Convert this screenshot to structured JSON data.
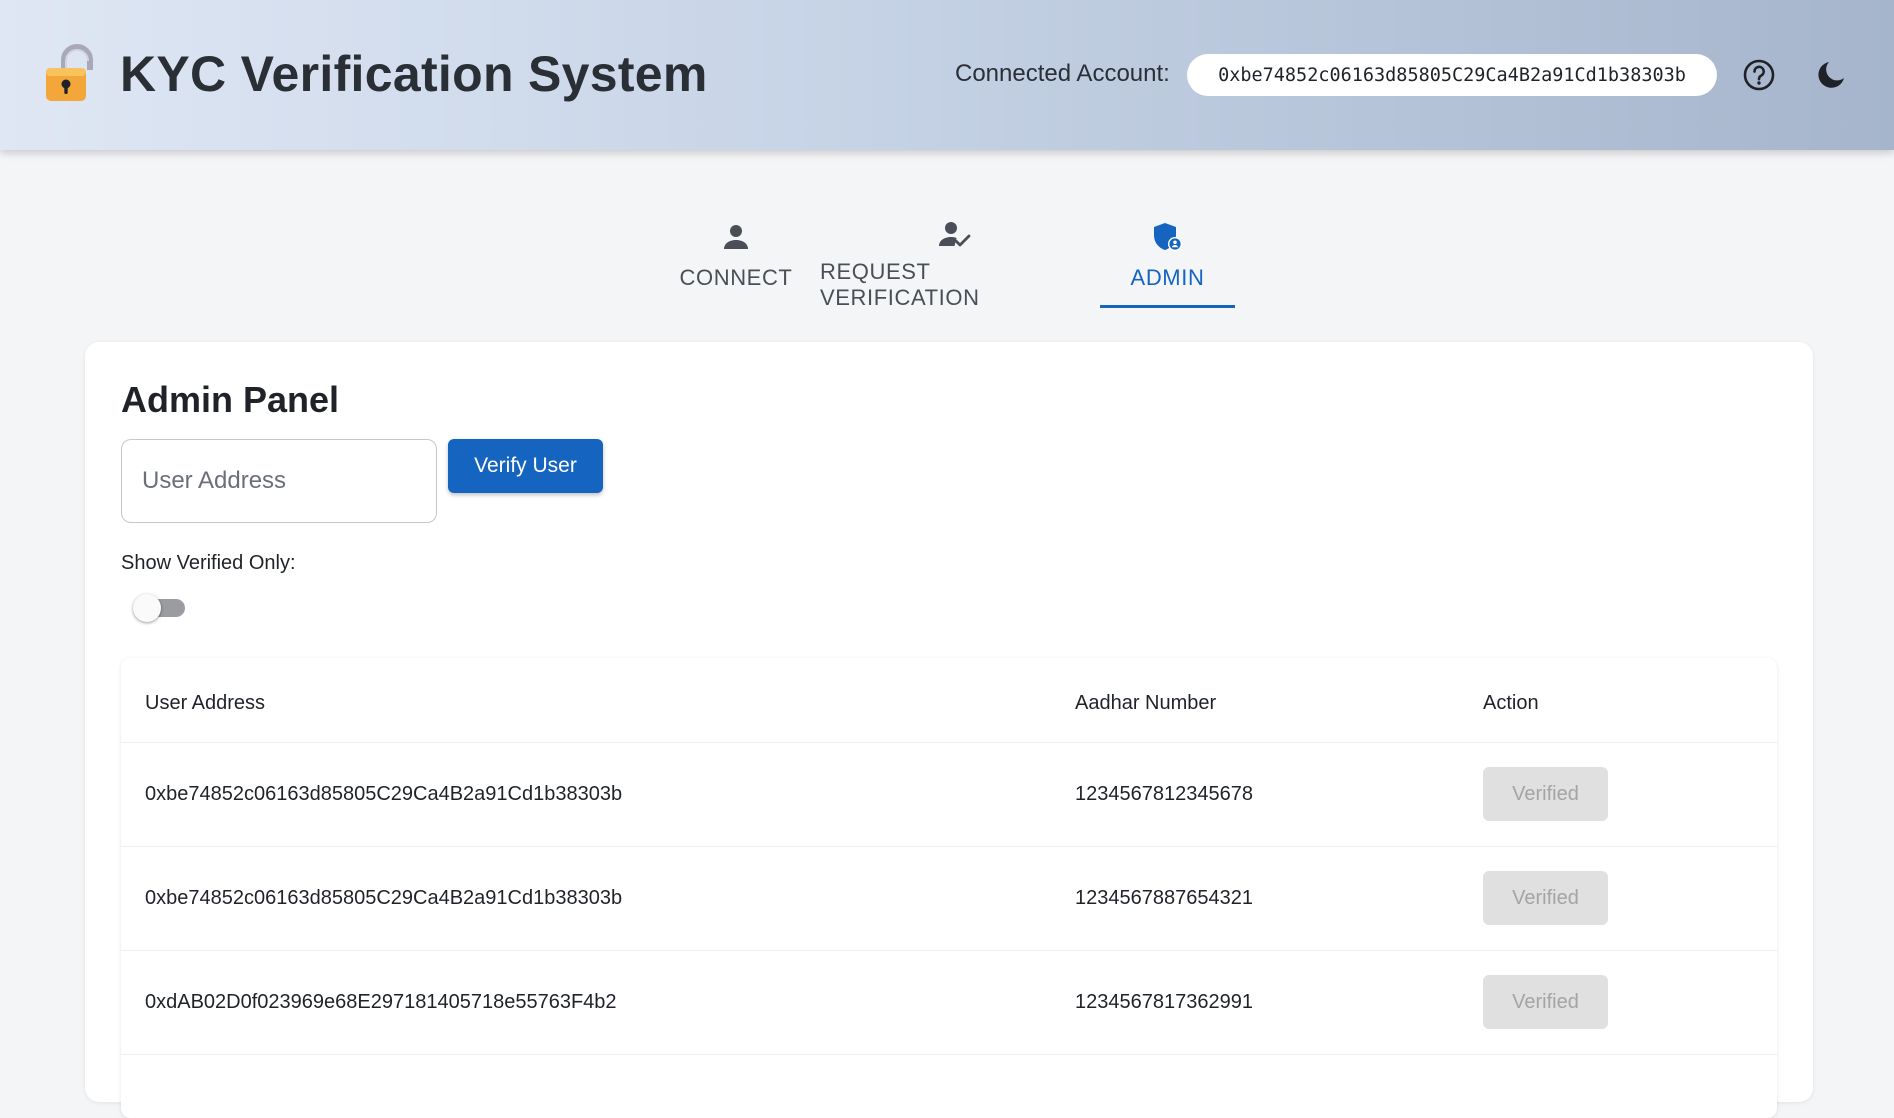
{
  "header": {
    "title": "KYC Verification System",
    "account_label": "Connected Account:",
    "account_address": "0xbe74852c06163d85805C29Ca4B2a91Cd1b38303b",
    "help_icon": "help-circle-icon",
    "theme_icon": "moon-icon",
    "logo_icon": "lock-icon"
  },
  "tabs": [
    {
      "label": "CONNECT",
      "icon": "person-icon",
      "active": false
    },
    {
      "label": "REQUEST VERIFICATION",
      "icon": "person-check-icon",
      "active": false
    },
    {
      "label": "ADMIN",
      "icon": "admin-shield-icon",
      "active": true
    }
  ],
  "admin": {
    "title": "Admin Panel",
    "input_placeholder": "User Address",
    "verify_label": "Verify User",
    "filter_label": "Show Verified Only:",
    "show_verified_only": false
  },
  "table": {
    "headers": [
      "User Address",
      "Aadhar Number",
      "Action"
    ],
    "rows": [
      {
        "address": "0xbe74852c06163d85805C29Ca4B2a91Cd1b38303b",
        "aadhar": "1234567812345678",
        "action": "Verified"
      },
      {
        "address": "0xbe74852c06163d85805C29Ca4B2a91Cd1b38303b",
        "aadhar": "1234567887654321",
        "action": "Verified"
      },
      {
        "address": "0xdAB02D0f023969e68E297181405718e55763F4b2",
        "aadhar": "1234567817362991",
        "action": "Verified"
      }
    ]
  },
  "colors": {
    "accent": "#1565c0",
    "disabled_bg": "#e0e0e0",
    "disabled_text": "#a4a4a4"
  }
}
